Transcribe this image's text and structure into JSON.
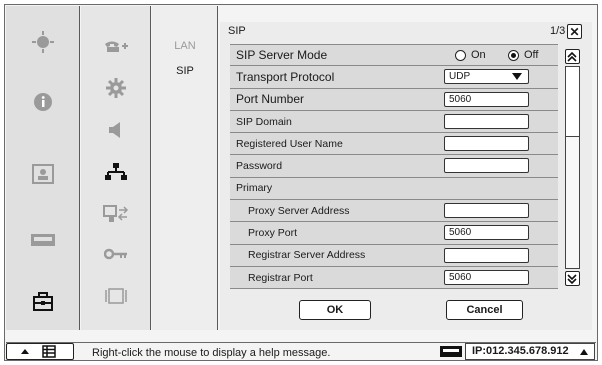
{
  "panel": {
    "title": "SIP",
    "page": "1/3",
    "close_symbol": "✕"
  },
  "submenu": {
    "items": [
      "LAN",
      "SIP"
    ],
    "selected": "SIP"
  },
  "rows": {
    "sip_server_mode": {
      "label": "SIP Server Mode",
      "on": "On",
      "off": "Off",
      "selected": "Off"
    },
    "transport_protocol": {
      "label": "Transport Protocol",
      "value": "UDP"
    },
    "port_number": {
      "label": "Port Number",
      "value": "5060"
    },
    "sip_domain": {
      "label": "SIP Domain",
      "value": ""
    },
    "registered_user_name": {
      "label": "Registered User Name",
      "value": ""
    },
    "password": {
      "label": "Password",
      "value": ""
    },
    "primary": {
      "label": "Primary"
    },
    "proxy_server_address": {
      "label": "Proxy Server Address",
      "value": ""
    },
    "proxy_port": {
      "label": "Proxy Port",
      "value": "5060"
    },
    "registrar_server_address": {
      "label": "Registrar Server Address",
      "value": ""
    },
    "registrar_port": {
      "label": "Registrar Port",
      "value": "5060"
    }
  },
  "buttons": {
    "ok": "OK",
    "cancel": "Cancel"
  },
  "scrollbar": {
    "position_fraction": 0.0,
    "visible_fraction": 0.33
  },
  "status": {
    "message": "Right-click the mouse to display a help message.",
    "ip": "IP:012.345.678.912"
  },
  "icons": {
    "col1": [
      "camera-control-icon",
      "info-icon",
      "picture-icon",
      "display-icon",
      "toolbox-icon"
    ],
    "col2": [
      "phone-icon",
      "gear-icon",
      "speaker-icon",
      "network-icon",
      "device-swap-icon",
      "key-icon",
      "frame-icon"
    ]
  }
}
